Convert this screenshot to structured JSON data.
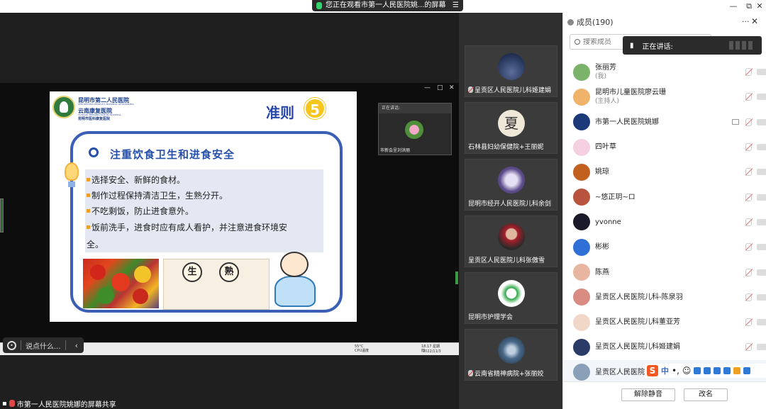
{
  "window": {
    "share_banner": "您正在观看市第一人民医院姚...的屏幕",
    "minimize": "—",
    "restore": "⧉",
    "close": "✕"
  },
  "slide": {
    "logo_line1": "昆明市第二人民医院",
    "logo_line2": "THE SECOND PEOPLE'S HOSPITAL OF KUNMING",
    "logo_line3": "云南康复医院",
    "logo_line4": "YUNNAN REHABILITATION HOSPITAL",
    "logo_line5": "昆明市医科康复医院",
    "rule_title": "准则",
    "rule_number": "5",
    "section_title": "注重饮食卫生和进食安全",
    "bullets": [
      "选择安全、新鲜的食材。",
      "制作过程保持清洁卫生，生熟分开。",
      "不吃剩饭，防止进食意外。",
      "饭前洗手，进食时应有成人看护，并注意进食环境安"
    ],
    "bullet_wrap": "全。",
    "kitchen_labels": [
      "生",
      "熟"
    ]
  },
  "mini_window": {
    "header": "正在讲话:",
    "name": "市新会呈刘洪丽"
  },
  "shared_taskbar": {
    "cpu": "55°C CPU温度",
    "time": "18:17 星期四",
    "date": "2022/11/3"
  },
  "chat": {
    "placeholder": "说点什么...",
    "collapse": "‹"
  },
  "bottom_status": "市第一人民医院姚娜的屏幕共享",
  "video_tiles": [
    {
      "name": "呈贡区人民医院儿科姬建娟",
      "muted": true
    },
    {
      "name": "石林县妇幼保健院+王丽妮",
      "muted": false,
      "avatar_text": "夏"
    },
    {
      "name": "昆明市经开人民医院儿科余剑",
      "muted": false
    },
    {
      "name": "呈贡区人民医院儿科张傲雪",
      "muted": false
    },
    {
      "name": "昆明市护理学会",
      "muted": false
    },
    {
      "name": "云南省精神病院+张丽姣",
      "muted": true
    }
  ],
  "panel": {
    "title": "成员(190)",
    "more": "···",
    "close": "✕",
    "search_placeholder": "搜索成员",
    "speaking_label": "正在讲话:",
    "members": [
      {
        "name": "张丽芳",
        "role": "(我)",
        "color": "#7bb36b"
      },
      {
        "name": "昆明市儿童医院廖云珊",
        "role": "(主持人)",
        "color": "#f0b36a"
      },
      {
        "name": "市第一人民医院姚娜",
        "role": "",
        "color": "#1c3a7a"
      },
      {
        "name": "四叶草",
        "role": "",
        "color": "#f4d0e0"
      },
      {
        "name": "姚琼",
        "role": "",
        "color": "#c2611f"
      },
      {
        "name": "~悠正玥~ロ",
        "role": "",
        "color": "#b8533e"
      },
      {
        "name": "yvonne",
        "role": "",
        "color": "#1a1a2a"
      },
      {
        "name": "彬彬",
        "role": "",
        "color": "#2f6fd6"
      },
      {
        "name": "陈燕",
        "role": "",
        "color": "#e8b6a0"
      },
      {
        "name": "呈贡区人民医院儿科-陈泉羽",
        "role": "",
        "color": "#d98c82"
      },
      {
        "name": "呈贡区人民医院儿科董亚芳",
        "role": "",
        "color": "#f1d7c7"
      },
      {
        "name": "呈贡区人民医院儿科姬建娟",
        "role": "",
        "color": "#2a3b68"
      },
      {
        "name": "呈贡区人民医院",
        "role": "",
        "color": "#8aa0b8"
      }
    ],
    "ime_zh": "中",
    "unmute_all": "解除静音",
    "rename": "改名"
  }
}
